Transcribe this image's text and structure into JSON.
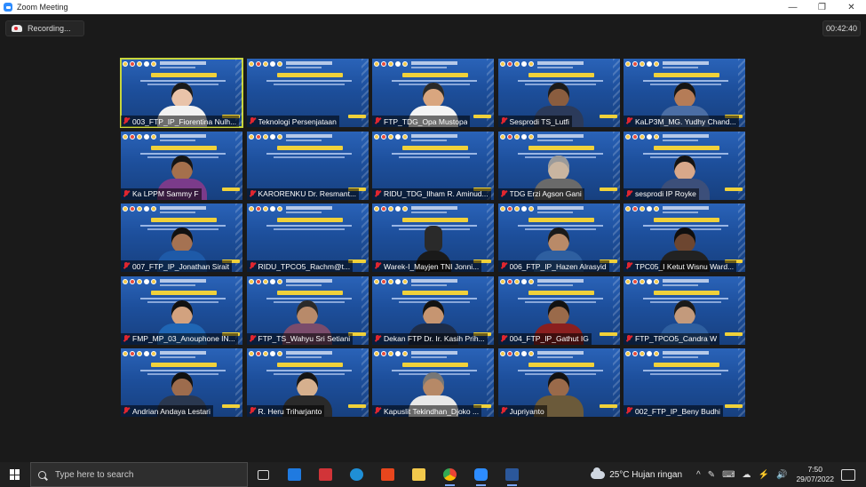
{
  "window": {
    "title": "Zoom Meeting",
    "min_label": "—",
    "restore_label": "❐",
    "close_label": "✕"
  },
  "meeting": {
    "recording_label": "Recording...",
    "elapsed": "00:42:40"
  },
  "participants": [
    {
      "name": "003_FTP_IP_Fiorentina Nulh...",
      "video": "person",
      "skin": "#e9c3a9",
      "hair": "#1a1a1a",
      "shirt": "#f2f2f2",
      "active": true
    },
    {
      "name": "Teknologi Persenjataan",
      "video": "slide"
    },
    {
      "name": "FTP_TDG_Opa Mustopa",
      "video": "person",
      "skin": "#d9a67f",
      "hair": "#2a2a2a",
      "shirt": "#f4f4f4"
    },
    {
      "name": "Sesprodi TS_Lutfi",
      "video": "person",
      "skin": "#8a5d3f",
      "hair": "#1b1b1b",
      "shirt": "#2b3a5a"
    },
    {
      "name": "KaLP3M_MG. Yudhy Chand...",
      "video": "person",
      "skin": "#b57c57",
      "hair": "#151515",
      "shirt": "#4b6ea5"
    },
    {
      "name": "Ka LPPM Sammy F",
      "video": "person",
      "skin": "#a5704c",
      "hair": "#151515",
      "shirt": "#7b3b8a"
    },
    {
      "name": "KARORENKU Dr. Resmant...",
      "video": "slide"
    },
    {
      "name": "RIDU_TDG_Ilham R. Aminud...",
      "video": "slide"
    },
    {
      "name": "TDG Erzi Agson Gani",
      "video": "person",
      "skin": "#c9b5a0",
      "hair": "#9a9a9a",
      "shirt": "#6a6a6a"
    },
    {
      "name": "sesprodi IP Royke",
      "video": "person",
      "skin": "#d8a88a",
      "hair": "#141414",
      "shirt": "#3c4f7a"
    },
    {
      "name": "007_FTP_IP_Jonathan Sirait",
      "video": "person",
      "skin": "#a57252",
      "hair": "#111111",
      "shirt": "#1e5aa8"
    },
    {
      "name": "RIDU_TPCO5_Rachm@t...",
      "video": "slide"
    },
    {
      "name": "Warek-I_Mayjen TNI Jonni...",
      "video": "chair"
    },
    {
      "name": "006_FTP_IP_Hazen Alrasyid",
      "video": "person",
      "skin": "#b98a68",
      "hair": "#1a1a1a",
      "shirt": "#2e5fa0"
    },
    {
      "name": "TPC05_I Ketut Wisnu Ward...",
      "video": "person",
      "skin": "#6d4630",
      "hair": "#0f0f0f",
      "shirt": "#222222"
    },
    {
      "name": "FMP_MP_03_Anouphone IN...",
      "video": "person",
      "skin": "#d2a27f",
      "hair": "#111111",
      "shirt": "#1f66b5"
    },
    {
      "name": "FTP_TS_Wahyu Sri Setiani",
      "video": "person",
      "skin": "#b88a6a",
      "hair": "#2a2a2a",
      "shirt": "#7a4c6c"
    },
    {
      "name": "Dekan FTP Dr. Ir. Kasih Prih...",
      "video": "person",
      "skin": "#c69571",
      "hair": "#121212",
      "shirt": "#1d2d4a"
    },
    {
      "name": "004_FTP_IP_Gathut IG",
      "video": "person",
      "skin": "#9a6a4a",
      "hair": "#121212",
      "shirt": "#8a1f1f"
    },
    {
      "name": "FTP_TPCO5_Candra W",
      "video": "person",
      "skin": "#c39a7c",
      "hair": "#1a1a1a",
      "shirt": "#2e5fa0"
    },
    {
      "name": "Andrian Andaya Lestari",
      "video": "person",
      "skin": "#9d6c4d",
      "hair": "#111111",
      "shirt": "#2a3850"
    },
    {
      "name": "R. Heru Triharjanto",
      "video": "person",
      "skin": "#d6b08e",
      "hair": "#151515",
      "shirt": "#2a2a2a"
    },
    {
      "name": "Kapuslit Tekindhan_Djoko ...",
      "video": "person",
      "skin": "#b68967",
      "hair": "#777777",
      "shirt": "#e8e8e8"
    },
    {
      "name": "Jupriyanto",
      "video": "person",
      "skin": "#9a6a4a",
      "hair": "#121212",
      "shirt": "#6b5a3a"
    },
    {
      "name": "002_FTP_IP_Beny Budhi",
      "video": "slide"
    }
  ],
  "taskbar": {
    "search_placeholder": "Type here to search",
    "weather_text": "25°C  Hujan ringan",
    "time": "7:50",
    "date": "29/07/2022",
    "icons": [
      "task-view-icon",
      "mail-icon",
      "gift-icon",
      "edge-icon",
      "office-icon",
      "file-explorer-icon",
      "chrome-icon",
      "zoom-icon",
      "word-icon"
    ],
    "colors": {
      "mail": "#1f7ae0",
      "gift": "#d13438",
      "edge": "#1f8fd6",
      "office": "#e8461d",
      "explorer": "#f2c94c",
      "chrome": "#34a853",
      "zoom": "#2d8cff",
      "word": "#2b579a"
    },
    "tray_symbols": [
      "^",
      "✎",
      "⌨",
      "☁",
      "⚡",
      "🔊"
    ]
  }
}
